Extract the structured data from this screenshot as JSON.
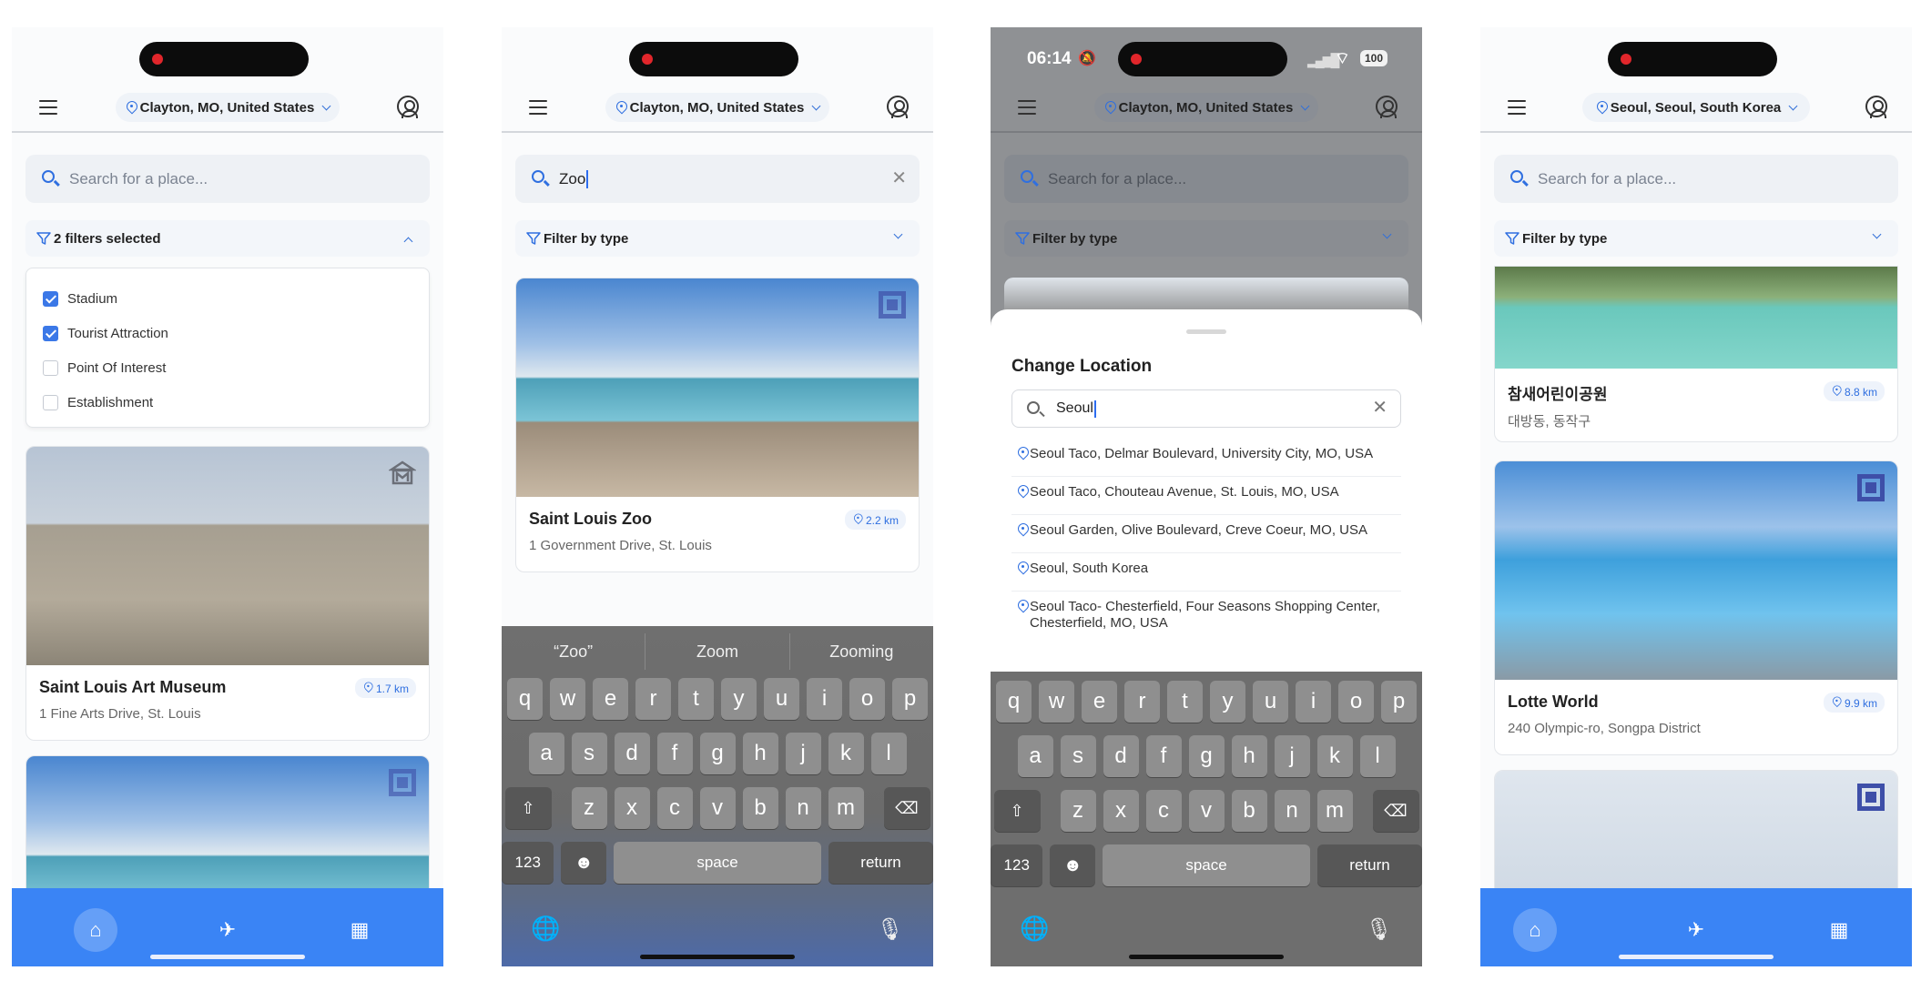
{
  "colors": {
    "accent": "#3a84f5",
    "nav_bg": "#3a84f5",
    "checkbox": "#3b78e7",
    "icon_blue": "#2f6fe0"
  },
  "common": {
    "search_placeholder": "Search for a place...",
    "filter_by_type": "Filter by type"
  },
  "screen1": {
    "location": "Clayton, MO, United States",
    "filter_label": "2 filters selected",
    "filter_options": [
      {
        "label": "Stadium",
        "checked": true
      },
      {
        "label": "Tourist Attraction",
        "checked": true
      },
      {
        "label": "Point Of Interest",
        "checked": false
      },
      {
        "label": "Establishment",
        "checked": false
      }
    ],
    "cards": [
      {
        "title": "Saint Louis Art Museum",
        "address": "1 Fine Arts Drive, St. Louis",
        "distance": "1.7 km",
        "type_icon": "museum-icon"
      }
    ],
    "nav": [
      "home-icon",
      "plane-icon",
      "calendar-icon"
    ]
  },
  "screen2": {
    "location": "Clayton, MO, United States",
    "search_value": "Zoo",
    "card": {
      "title": "Saint Louis Zoo",
      "address": "1 Government Drive, St. Louis",
      "distance": "2.2 km"
    },
    "suggestions": [
      "“Zoo”",
      "Zoom",
      "Zooming"
    ]
  },
  "screen3": {
    "status_time": "06:14",
    "battery": "100",
    "location": "Clayton, MO, United States",
    "sheet_title": "Change Location",
    "sheet_search_value": "Seoul",
    "results": [
      "Seoul Taco, Delmar Boulevard, University City, MO, USA",
      "Seoul Taco, Chouteau Avenue, St. Louis, MO, USA",
      "Seoul Garden, Olive Boulevard, Creve Coeur, MO, USA",
      "Seoul, South Korea",
      "Seoul Taco- Chesterfield, Four Seasons Shopping Center, Chesterfield, MO, USA"
    ]
  },
  "screen4": {
    "location": "Seoul, Seoul, South Korea",
    "cards": [
      {
        "title": "참새어린이공원",
        "address": "대방동, 동작구",
        "distance": "8.8 km"
      },
      {
        "title": "Lotte World",
        "address": "240 Olympic-ro, Songpa District",
        "distance": "9.9 km"
      }
    ]
  },
  "keyboard": {
    "row1": [
      "q",
      "w",
      "e",
      "r",
      "t",
      "y",
      "u",
      "i",
      "o",
      "p"
    ],
    "row2": [
      "a",
      "s",
      "d",
      "f",
      "g",
      "h",
      "j",
      "k",
      "l"
    ],
    "row3": [
      "z",
      "x",
      "c",
      "v",
      "b",
      "n",
      "m"
    ],
    "shift": "⇧",
    "backspace": "⌫",
    "numbers": "123",
    "emoji": "☻",
    "space": "space",
    "return": "return",
    "globe": "🌐",
    "mic": "🎙"
  }
}
